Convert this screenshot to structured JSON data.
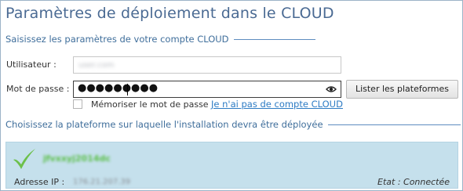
{
  "page": {
    "title": "Paramètres de déploiement dans le CLOUD"
  },
  "account_section": {
    "heading": "Saisissez les paramètres de votre compte CLOUD",
    "user_label": "Utilisateur :",
    "user_value": "user.com",
    "password_label": "Mot de passe :",
    "password_value": "●●●●●●●●●",
    "list_button": "Lister les plateformes",
    "remember_label": "Mémoriser le mot de passe",
    "remember_checked": false,
    "no_account_link": "Je n'ai pas de compte CLOUD",
    "eye_icon": "eye-icon"
  },
  "platform_section": {
    "heading": "Choisissez la plateforme sur laquelle l'installation devra être déployée",
    "platforms": [
      {
        "name": "jfvxxyj2014dc",
        "ip_label": "Adresse IP :",
        "ip_value": "176.21.207.39",
        "state": "Etat : Connectée",
        "status_icon": "check-icon"
      }
    ]
  },
  "colors": {
    "title": "#4a6a93",
    "section_heading": "#3f6e9b",
    "link": "#2c7bc4",
    "card_bg": "#c5e0ec",
    "check_green": "#6cc04a"
  }
}
